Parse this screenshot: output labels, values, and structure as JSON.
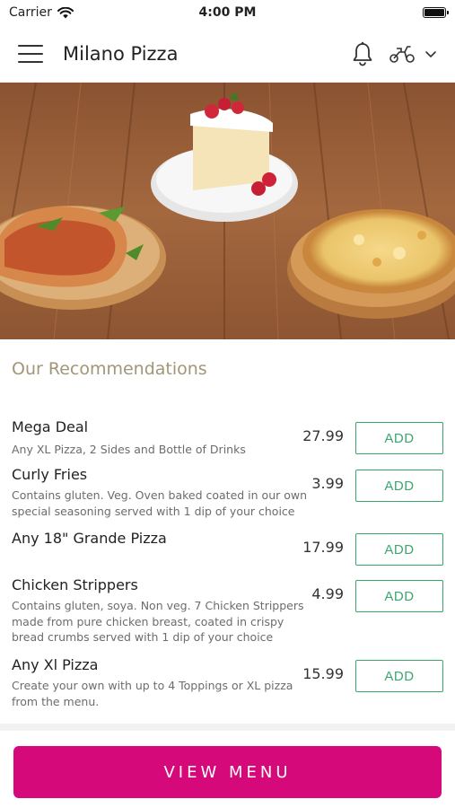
{
  "status": {
    "carrier": "Carrier",
    "time": "4:00 PM"
  },
  "header": {
    "title": "Milano Pizza"
  },
  "recommendations": {
    "title": "Our Recommendations",
    "items": [
      {
        "name": "Mega Deal",
        "desc": "Any XL Pizza, 2 Sides and Bottle of Drinks",
        "price": "27.99",
        "add_label": "ADD"
      },
      {
        "name": "Curly Fries",
        "desc": "Contains gluten. Veg. Oven baked coated in our own special seasoning served with 1 dip of your choice",
        "price": "3.99",
        "add_label": "ADD"
      },
      {
        "name": "Any 18\" Grande Pizza",
        "desc": "",
        "price": "17.99",
        "add_label": "ADD"
      },
      {
        "name": "Chicken Strippers",
        "desc": "Contains gluten, soya. Non veg. 7 Chicken Strippers made from pure chicken breast, coated in crispy bread crumbs served with 1 dip of your choice",
        "price": "4.99",
        "add_label": "ADD"
      },
      {
        "name": "Any Xl Pizza",
        "desc": "Create your own with up to 4 Toppings or XL pizza from the menu.",
        "price": "15.99",
        "add_label": "ADD"
      }
    ]
  },
  "footer": {
    "view_menu_label": "VIEW MENU"
  },
  "colors": {
    "accent": "#d6097b",
    "add_green": "#3aa76d",
    "section_title": "#a39577"
  },
  "icons": {
    "menu": "hamburger-icon",
    "notifications": "bell-icon",
    "delivery": "scooter-icon",
    "dropdown": "chevron-down-icon",
    "wifi": "wifi-icon",
    "battery": "battery-icon"
  }
}
